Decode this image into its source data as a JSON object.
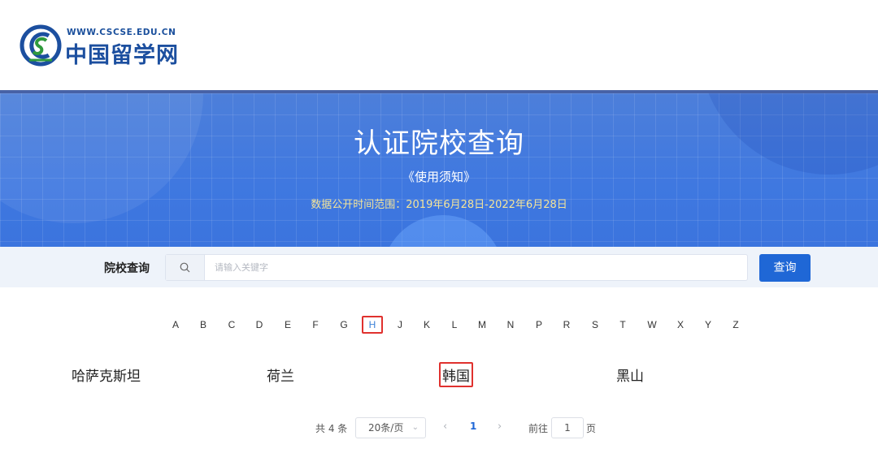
{
  "header": {
    "logo_url_text": "WWW.CSCSE.EDU.CN",
    "logo_cn_text": "中国留学网"
  },
  "banner": {
    "title": "认证院校查询",
    "notice_link": "《使用须知》",
    "date_range": "数据公开时间范围：2019年6月28日-2022年6月28日"
  },
  "search": {
    "label": "院校查询",
    "placeholder": "请输入关键字",
    "value": "",
    "button_label": "查询"
  },
  "letters": [
    "A",
    "B",
    "C",
    "D",
    "E",
    "F",
    "G",
    "H",
    "J",
    "K",
    "L",
    "M",
    "N",
    "P",
    "R",
    "S",
    "T",
    "W",
    "X",
    "Y",
    "Z"
  ],
  "active_letter": "H",
  "results": [
    "哈萨克斯坦",
    "荷兰",
    "韩国",
    "黑山"
  ],
  "highlighted_result": "韩国",
  "pagination": {
    "total_text": "共 4 条",
    "page_size": "20条/页",
    "current_page": "1",
    "goto_label": "前往",
    "goto_value": "1",
    "page_unit": "页"
  },
  "colors": {
    "primary": "#1f67d6",
    "banner": "#3f78e0",
    "highlight_border": "#e0312e",
    "date_text": "#f4e49a"
  }
}
